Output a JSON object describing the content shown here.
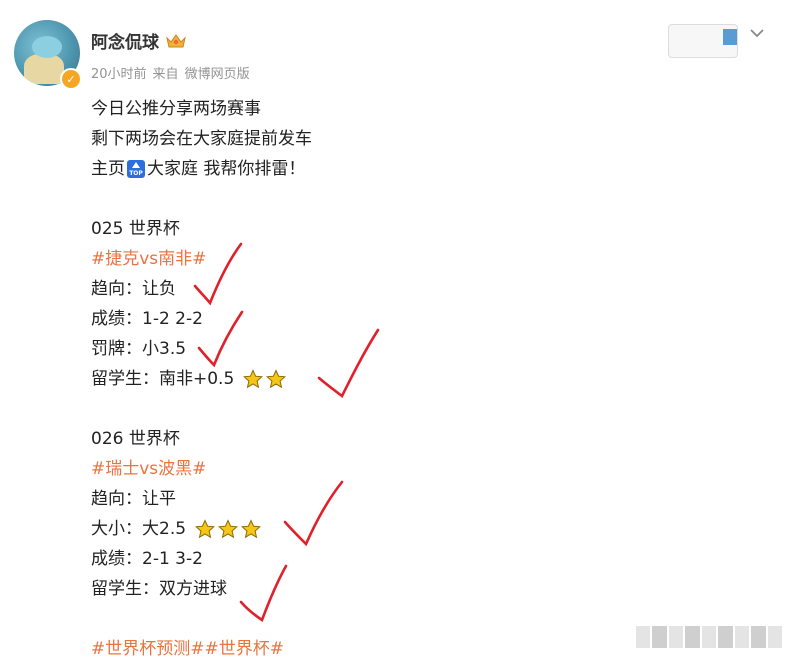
{
  "post": {
    "username": "阿念侃球",
    "time": "20小时前",
    "source_prefix": "来自",
    "source": "微博网页版",
    "intro": [
      "今日公推分享两场赛事",
      "剩下两场会在大家庭提前发车"
    ],
    "homepage_line": {
      "before": "主页",
      "after": "大家庭 我帮你排雷！"
    },
    "match1": {
      "header": "025 世界杯",
      "tag": "#捷克vs南非#",
      "trend": "趋向：让负",
      "score": "成绩：1-2 2-2",
      "cards": "罚牌：小3.5",
      "student": "留学生：南非+0.5",
      "student_stars": 2
    },
    "match2": {
      "header": "026 世界杯",
      "tag": "#瑞士vs波黑#",
      "trend": "趋向：让平",
      "size": "大小：大2.5",
      "size_stars": 3,
      "score": "成绩：2-1 3-2",
      "student": "留学生：双方进球"
    },
    "hashtags": "#世界杯预测##世界杯#"
  },
  "colors": {
    "tag": "#eb7340",
    "check_mark": "#e0202a",
    "star": "#f5c518"
  }
}
